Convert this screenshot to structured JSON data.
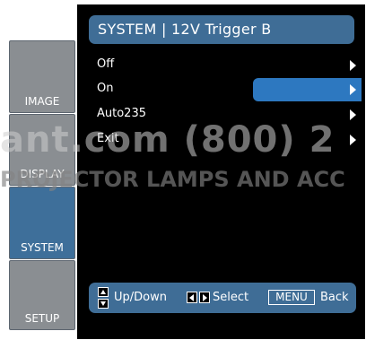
{
  "title": "SYSTEM | 12V Trigger B",
  "tabs": [
    {
      "label": "IMAGE"
    },
    {
      "label": "DISPLAY"
    },
    {
      "label": "SYSTEM"
    },
    {
      "label": "SETUP"
    }
  ],
  "menu": [
    {
      "label": "Off"
    },
    {
      "label": "On"
    },
    {
      "label": "Auto235"
    },
    {
      "label": "Exit"
    }
  ],
  "help": {
    "updown": "Up/Down",
    "select": "Select",
    "menu_key": "MENU",
    "back": "Back"
  },
  "watermark": {
    "line1": "ant.com (800) 2",
    "line2": "PROJECTOR LAMPS AND ACC"
  },
  "colors": {
    "accent": "#3f6d96",
    "selected": "#2d78c0",
    "tab_active": "#3e6f9a"
  },
  "icons": [
    "chevron-right-icon",
    "up-arrow-icon",
    "down-arrow-icon",
    "left-arrow-icon",
    "right-arrow-icon"
  ]
}
